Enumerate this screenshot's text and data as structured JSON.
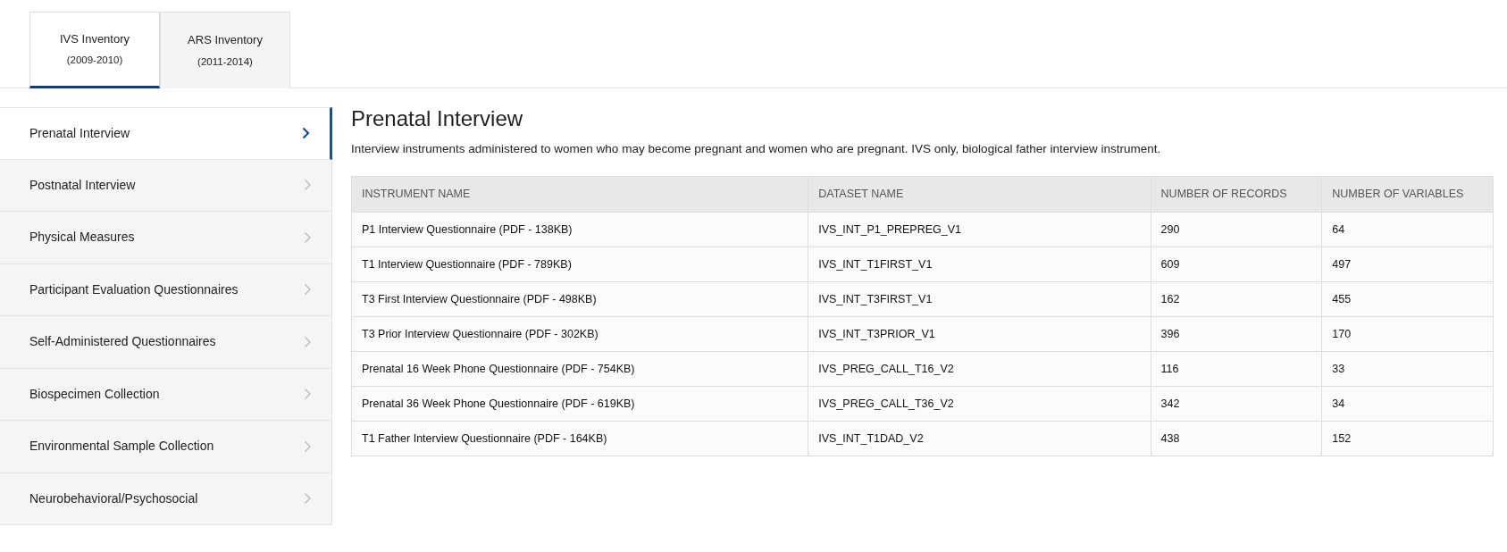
{
  "tabs": [
    {
      "label": "IVS Inventory",
      "years": "(2009-2010)",
      "selected": true
    },
    {
      "label": "ARS Inventory",
      "years": "(2011-2014)",
      "selected": false
    }
  ],
  "sidebar": {
    "items": [
      {
        "label": "Prenatal Interview",
        "selected": true
      },
      {
        "label": "Postnatal Interview",
        "selected": false
      },
      {
        "label": "Physical Measures",
        "selected": false
      },
      {
        "label": "Participant Evaluation Questionnaires",
        "selected": false
      },
      {
        "label": "Self-Administered Questionnaires",
        "selected": false
      },
      {
        "label": "Biospecimen Collection",
        "selected": false
      },
      {
        "label": "Environmental Sample Collection",
        "selected": false
      },
      {
        "label": "Neurobehavioral/Psychosocial",
        "selected": false
      }
    ]
  },
  "content": {
    "title": "Prenatal Interview",
    "description": "Interview instruments administered to women who may become pregnant and women who are pregnant. IVS only, biological father interview instrument.",
    "table": {
      "columns": [
        "INSTRUMENT NAME",
        "DATASET NAME",
        "NUMBER OF RECORDS",
        "NUMBER OF VARIABLES"
      ],
      "rows": [
        [
          "P1 Interview Questionnaire (PDF - 138KB)",
          "IVS_INT_P1_PREPREG_V1",
          "290",
          "64"
        ],
        [
          "T1 Interview Questionnaire (PDF - 789KB)",
          "IVS_INT_T1FIRST_V1",
          "609",
          "497"
        ],
        [
          "T3 First Interview Questionnaire (PDF - 498KB)",
          "IVS_INT_T3FIRST_V1",
          "162",
          "455"
        ],
        [
          "T3 Prior Interview Questionnaire (PDF - 302KB)",
          "IVS_INT_T3PRIOR_V1",
          "396",
          "170"
        ],
        [
          "Prenatal 16 Week Phone Questionnaire (PDF - 754KB)",
          "IVS_PREG_CALL_T16_V2",
          "116",
          "33"
        ],
        [
          "Prenatal 36 Week Phone Questionnaire (PDF - 619KB)",
          "IVS_PREG_CALL_T36_V2",
          "342",
          "34"
        ],
        [
          "T1 Father Interview Questionnaire (PDF - 164KB)",
          "IVS_INT_T1DAD_V2",
          "438",
          "152"
        ]
      ]
    }
  }
}
